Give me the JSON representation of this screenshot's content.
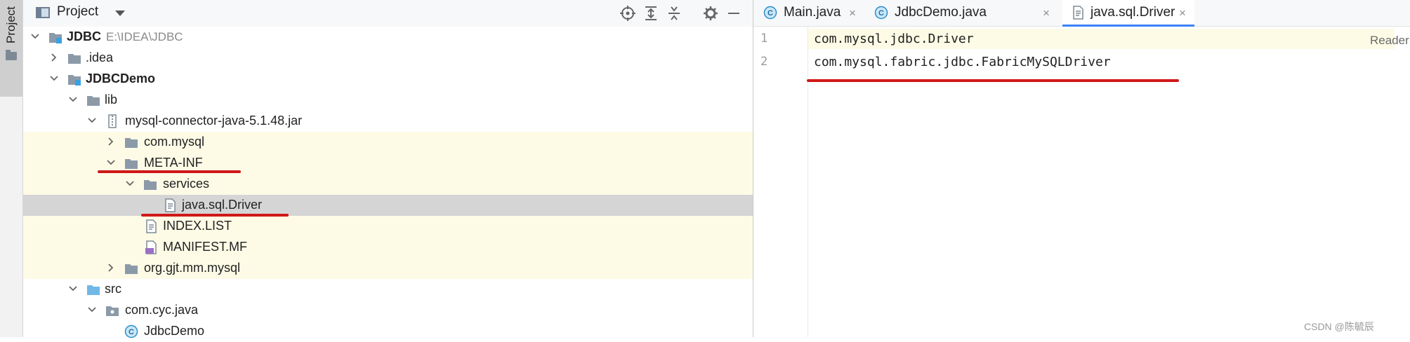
{
  "sidebar_stripe": {
    "label": "Project"
  },
  "project_panel": {
    "title": "Project",
    "tree": [
      {
        "label": "JDBC",
        "path": "E:\\IDEA\\JDBC"
      },
      {
        "label": ".idea"
      },
      {
        "label": "JDBCDemo"
      },
      {
        "label": "lib"
      },
      {
        "label": "mysql-connector-java-5.1.48.jar"
      },
      {
        "label": "com.mysql"
      },
      {
        "label": "META-INF"
      },
      {
        "label": "services"
      },
      {
        "label": "java.sql.Driver"
      },
      {
        "label": "INDEX.LIST"
      },
      {
        "label": "MANIFEST.MF"
      },
      {
        "label": "org.gjt.mm.mysql"
      },
      {
        "label": "src"
      },
      {
        "label": "com.cyc.java"
      },
      {
        "label": "JdbcDemo"
      }
    ]
  },
  "editor": {
    "tabs": [
      {
        "label": "Main.java",
        "close": "×"
      },
      {
        "label": "JdbcDemo.java",
        "close": "×"
      },
      {
        "label": "java.sql.Driver",
        "close": "×"
      }
    ],
    "line_numbers": [
      "1",
      "2"
    ],
    "lines": [
      "com.mysql.jdbc.Driver",
      "com.mysql.fabric.jdbc.FabricMySQLDriver"
    ],
    "reader_mode": "Reader"
  },
  "watermark": "CSDN @陈毓辰",
  "colors": {
    "highlight_row": "#fdfbe6",
    "selected_row": "#d5d5d5",
    "annotation_underline": "#d01818",
    "active_tab_indicator": "#3b82f6"
  }
}
